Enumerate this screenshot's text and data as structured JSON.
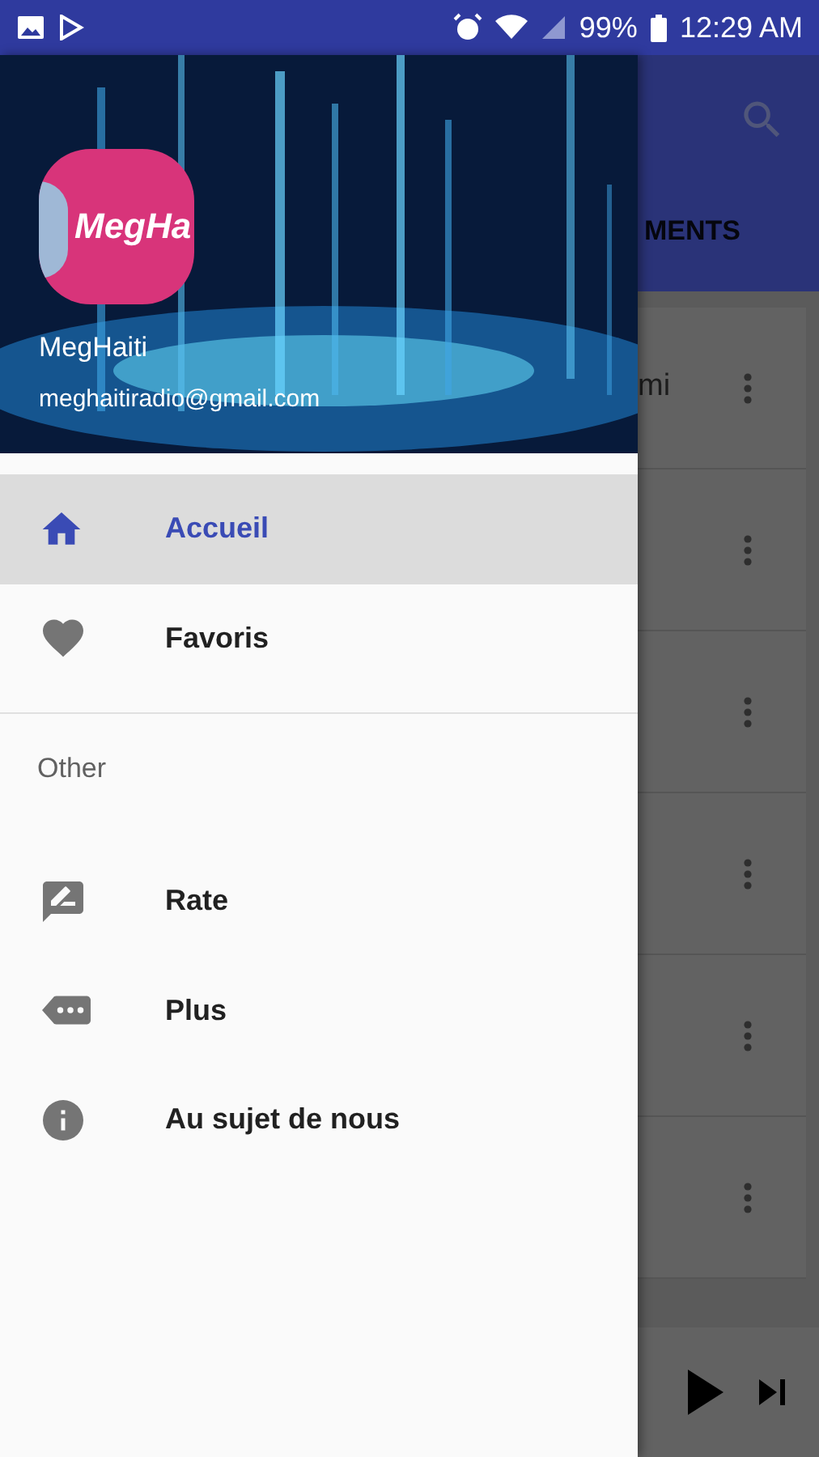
{
  "status_bar": {
    "battery": "99%",
    "time": "12:29 AM"
  },
  "drawer": {
    "logo_text": "MegHa",
    "app_name": "MegHaiti",
    "email": "meghaitiradio@gmail.com",
    "items": [
      {
        "label": "Accueil",
        "kind": "home",
        "selected": true
      },
      {
        "label": "Favoris",
        "kind": "heart",
        "selected": false
      }
    ],
    "section_header": "Other",
    "other_items": [
      {
        "label": "Rate",
        "kind": "rate",
        "selected": false
      },
      {
        "label": "Plus",
        "kind": "more",
        "selected": false
      },
      {
        "label": "Au sujet de nous",
        "kind": "info",
        "selected": false
      }
    ]
  },
  "background": {
    "tab_label": "MENTS",
    "rows": [
      {
        "kind": "titled",
        "title": "mi"
      },
      {
        "kind": "plain"
      },
      {
        "kind": "plain"
      },
      {
        "kind": "plain"
      },
      {
        "kind": "plain"
      },
      {
        "kind": "plain"
      }
    ]
  }
}
